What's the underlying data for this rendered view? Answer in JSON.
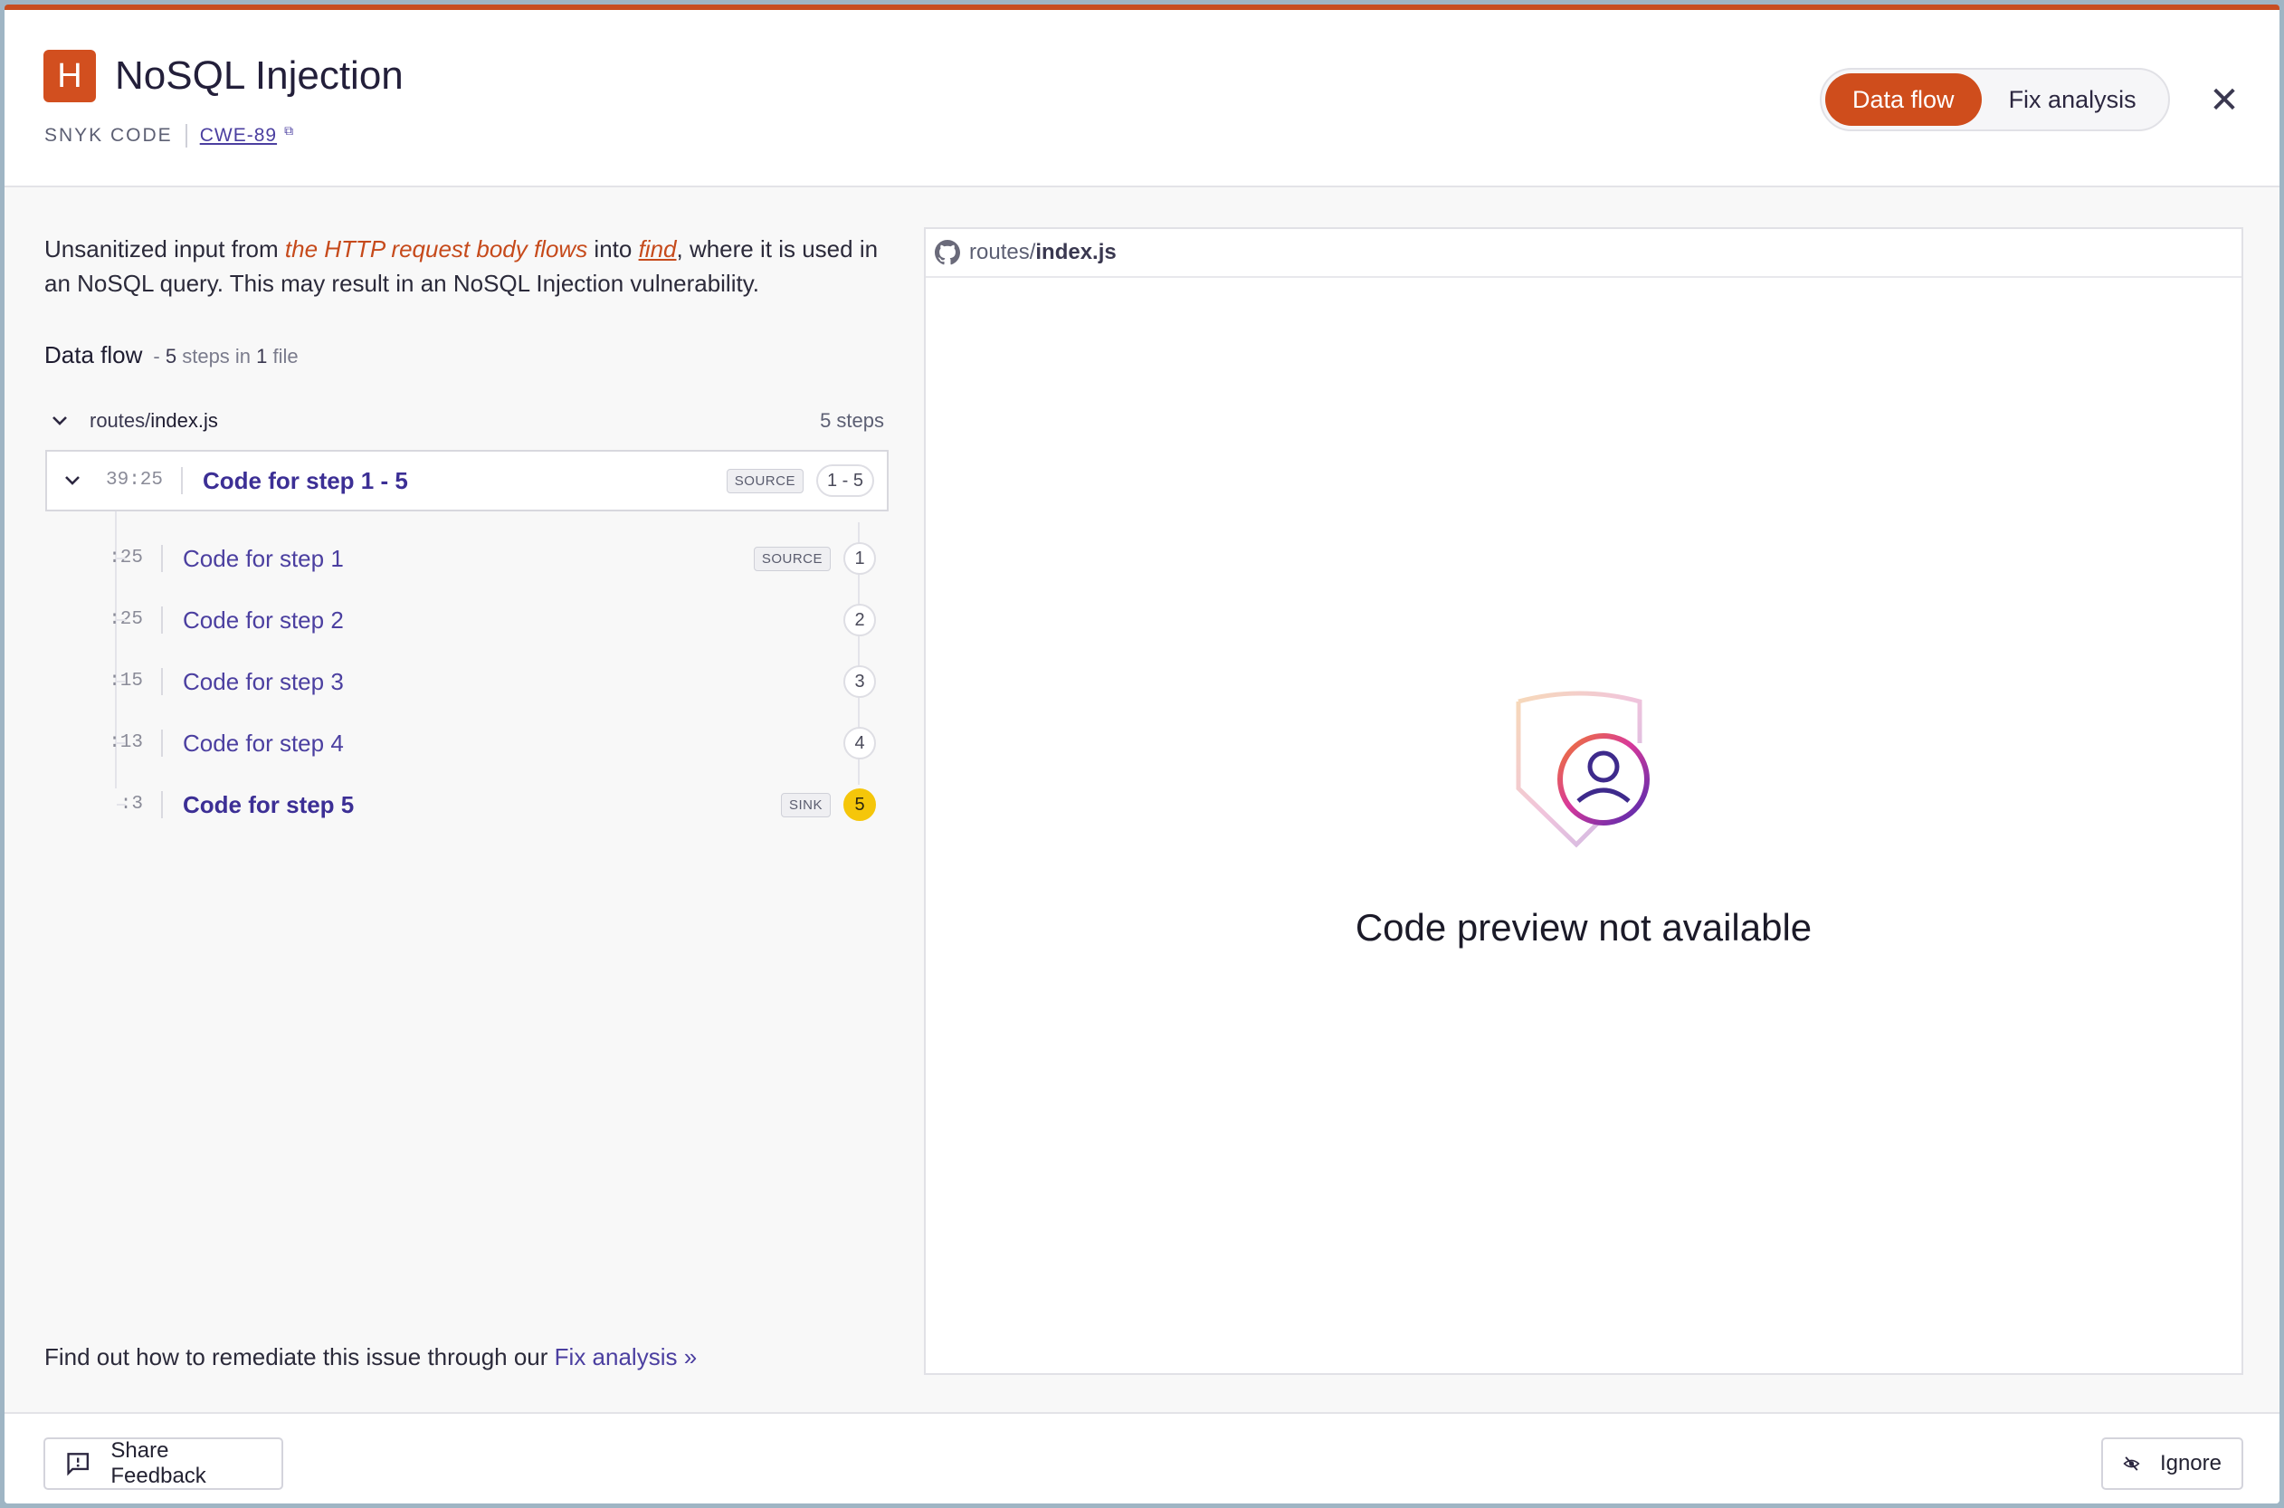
{
  "header": {
    "severity": "H",
    "title": "NoSQL Injection",
    "product": "SNYK CODE",
    "cwe": "CWE-89",
    "tabs": [
      "Data flow",
      "Fix analysis"
    ],
    "active_tab": "Data flow",
    "close_glyph": "✕"
  },
  "description": {
    "prefix": "Unsanitized input from ",
    "source": "the HTTP request body flows",
    "middle": " into ",
    "sink": "find",
    "suffix": ", where it is used in an NoSQL query. This may result in an NoSQL Injection vulnerability."
  },
  "data_flow": {
    "heading": "Data flow",
    "summary_sep": "-",
    "steps_count": "5",
    "summary_middle": "steps in",
    "files_count": "1",
    "summary_end": "file",
    "file_dir": "routes/",
    "file_name": "index.js",
    "file_steps": "5 steps",
    "group": {
      "line": "39:25",
      "label": "Code for step 1 - 5",
      "tag": "SOURCE",
      "range": "1 - 5"
    },
    "steps": [
      {
        "line": ":25",
        "label": "Code for step 1",
        "tag": "SOURCE",
        "num": "1"
      },
      {
        "line": ":25",
        "label": "Code for step 2",
        "tag": "",
        "num": "2"
      },
      {
        "line": ":15",
        "label": "Code for step 3",
        "tag": "",
        "num": "3"
      },
      {
        "line": ":13",
        "label": "Code for step 4",
        "tag": "",
        "num": "4"
      },
      {
        "line": ":3",
        "label": "Code for step 5",
        "tag": "SINK",
        "num": "5"
      }
    ]
  },
  "remediate": {
    "text": "Find out how to remediate this issue through our ",
    "link": "Fix analysis »"
  },
  "preview": {
    "dir": "routes/",
    "file": "index.js",
    "empty_message": "Code preview not available"
  },
  "footer": {
    "feedback_label": "Share Feedback",
    "ignore_label": "Ignore"
  },
  "colors": {
    "accent": "#cf4d1c",
    "link": "#4b3fa0",
    "sink": "#f5c60a"
  }
}
